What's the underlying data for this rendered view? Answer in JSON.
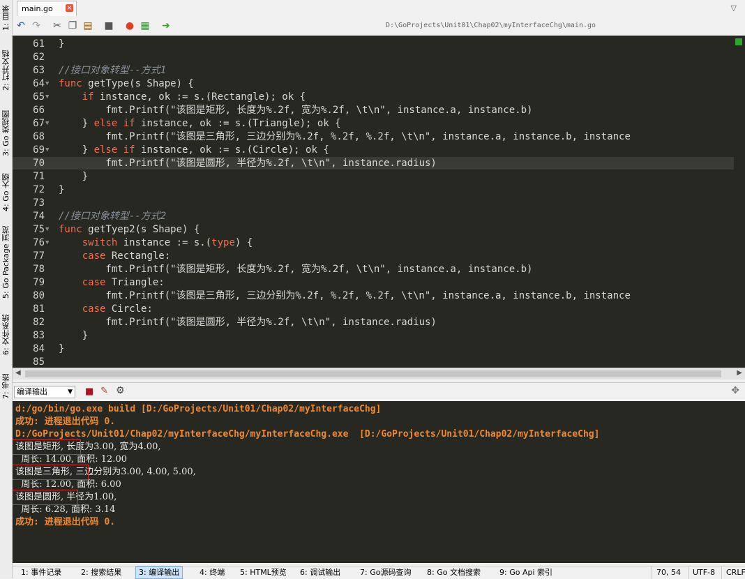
{
  "sidebar": {
    "tabs": [
      {
        "label": "1: 目录"
      },
      {
        "label": "2: 打开文档"
      },
      {
        "label": "3: Go 类视图"
      },
      {
        "label": "4: Go 大纲"
      },
      {
        "label": "5: Go Package 浏览"
      },
      {
        "label": "6: 文件系统"
      },
      {
        "label": "7: 书签"
      }
    ]
  },
  "tab_bar": {
    "file_tab": "main.go",
    "close_icon": "×",
    "dropdown_icon": "chevron-down-icon"
  },
  "toolbar": {
    "icons": [
      "undo-icon",
      "redo-icon",
      "cut-icon",
      "copy-icon",
      "paste-icon",
      "lock-icon",
      "record-icon",
      "export-icon",
      "run-icon"
    ],
    "file_path": "D:\\GoProjects\\Unit01\\Chap02\\myInterfaceChg\\main.go"
  },
  "editor": {
    "current_line": "70",
    "lines": [
      {
        "n": "61",
        "fold": "",
        "code": "}"
      },
      {
        "n": "62",
        "fold": "",
        "code": ""
      },
      {
        "n": "63",
        "fold": "",
        "code": "//接口对象转型--方式1"
      },
      {
        "n": "64",
        "fold": "▼",
        "code": "func getType(s Shape) {"
      },
      {
        "n": "65",
        "fold": "▼",
        "code": "    if instance, ok := s.(Rectangle); ok {"
      },
      {
        "n": "66",
        "fold": "",
        "code": "        fmt.Printf(\"该图是矩形, 长度为%.2f, 宽为%.2f, \\t\\n\", instance.a, instance.b)"
      },
      {
        "n": "67",
        "fold": "▼",
        "code": "    } else if instance, ok := s.(Triangle); ok {"
      },
      {
        "n": "68",
        "fold": "",
        "code": "        fmt.Printf(\"该图是三角形, 三边分别为%.2f, %.2f, %.2f, \\t\\n\", instance.a, instance.b, instance"
      },
      {
        "n": "69",
        "fold": "▼",
        "code": "    } else if instance, ok := s.(Circle); ok {"
      },
      {
        "n": "70",
        "fold": "",
        "code": "        fmt.Printf(\"该图是圆形, 半径为%.2f, \\t\\n\", instance.radius)"
      },
      {
        "n": "71",
        "fold": "",
        "code": "    }"
      },
      {
        "n": "72",
        "fold": "",
        "code": "}"
      },
      {
        "n": "73",
        "fold": "",
        "code": ""
      },
      {
        "n": "74",
        "fold": "",
        "code": "//接口对象转型--方式2"
      },
      {
        "n": "75",
        "fold": "▼",
        "code": "func getTyep2(s Shape) {"
      },
      {
        "n": "76",
        "fold": "▼",
        "code": "    switch instance := s.(type) {"
      },
      {
        "n": "77",
        "fold": "",
        "code": "    case Rectangle:"
      },
      {
        "n": "78",
        "fold": "",
        "code": "        fmt.Printf(\"该图是矩形, 长度为%.2f, 宽为%.2f, \\t\\n\", instance.a, instance.b)"
      },
      {
        "n": "79",
        "fold": "",
        "code": "    case Triangle:"
      },
      {
        "n": "80",
        "fold": "",
        "code": "        fmt.Printf(\"该图是三角形, 三边分别为%.2f, %.2f, %.2f, \\t\\n\", instance.a, instance.b, instance"
      },
      {
        "n": "81",
        "fold": "",
        "code": "    case Circle:"
      },
      {
        "n": "82",
        "fold": "",
        "code": "        fmt.Printf(\"该图是圆形, 半径为%.2f, \\t\\n\", instance.radius)"
      },
      {
        "n": "83",
        "fold": "",
        "code": "    }"
      },
      {
        "n": "84",
        "fold": "",
        "code": "}"
      },
      {
        "n": "85",
        "fold": "",
        "code": ""
      }
    ]
  },
  "output_panel": {
    "selector_label": "编译输出",
    "lines": [
      {
        "text": "d:/go/bin/go.exe build [D:/GoProjects/Unit01/Chap02/myInterfaceChg]",
        "style": "orange"
      },
      {
        "text": "成功: 进程退出代码 0.",
        "style": "orange"
      },
      {
        "text": "D:/GoProjects/Unit01/Chap02/myInterfaceChg/myInterfaceChg.exe  [D:/GoProjects/Unit01/Chap02/myInterfaceChg]",
        "style": "orange"
      },
      {
        "text": "该图是矩形, 长度为3.00, 宽为4.00,",
        "style": "plain"
      },
      {
        "text": "  周长: 14.00, 面积: 12.00",
        "style": "plain"
      },
      {
        "text": "该图是三角形, 三边分别为3.00, 4.00, 5.00,",
        "style": "plain"
      },
      {
        "text": "  周长: 12.00, 面积: 6.00",
        "style": "plain"
      },
      {
        "text": "该图是圆形, 半径为1.00,",
        "style": "plain"
      },
      {
        "text": "  周长: 6.28, 面积: 3.14",
        "style": "plain"
      },
      {
        "text": "成功: 进程退出代码 0.",
        "style": "orange"
      }
    ]
  },
  "status_bar": {
    "tabs": [
      {
        "label": "1: 事件记录",
        "active": false
      },
      {
        "label": "2: 搜索结果",
        "active": false
      },
      {
        "label": "3: 编译输出",
        "active": true
      },
      {
        "label": "4: 终端",
        "active": false
      },
      {
        "label": "5: HTML预览",
        "active": false
      },
      {
        "label": "6: 调试输出",
        "active": false
      },
      {
        "label": "7: Go源码查询",
        "active": false
      },
      {
        "label": "8: Go 文档搜索",
        "active": false
      },
      {
        "label": "9: Go Api 索引",
        "active": false
      }
    ],
    "cursor_position": "70, 54",
    "encoding": "UTF-8",
    "line_ending": "CRLF"
  },
  "colors": {
    "keyword": "#f46d52",
    "comment": "#8a8f9a",
    "output_highlight": "#f2892b",
    "highlight_box": "#d23030"
  }
}
